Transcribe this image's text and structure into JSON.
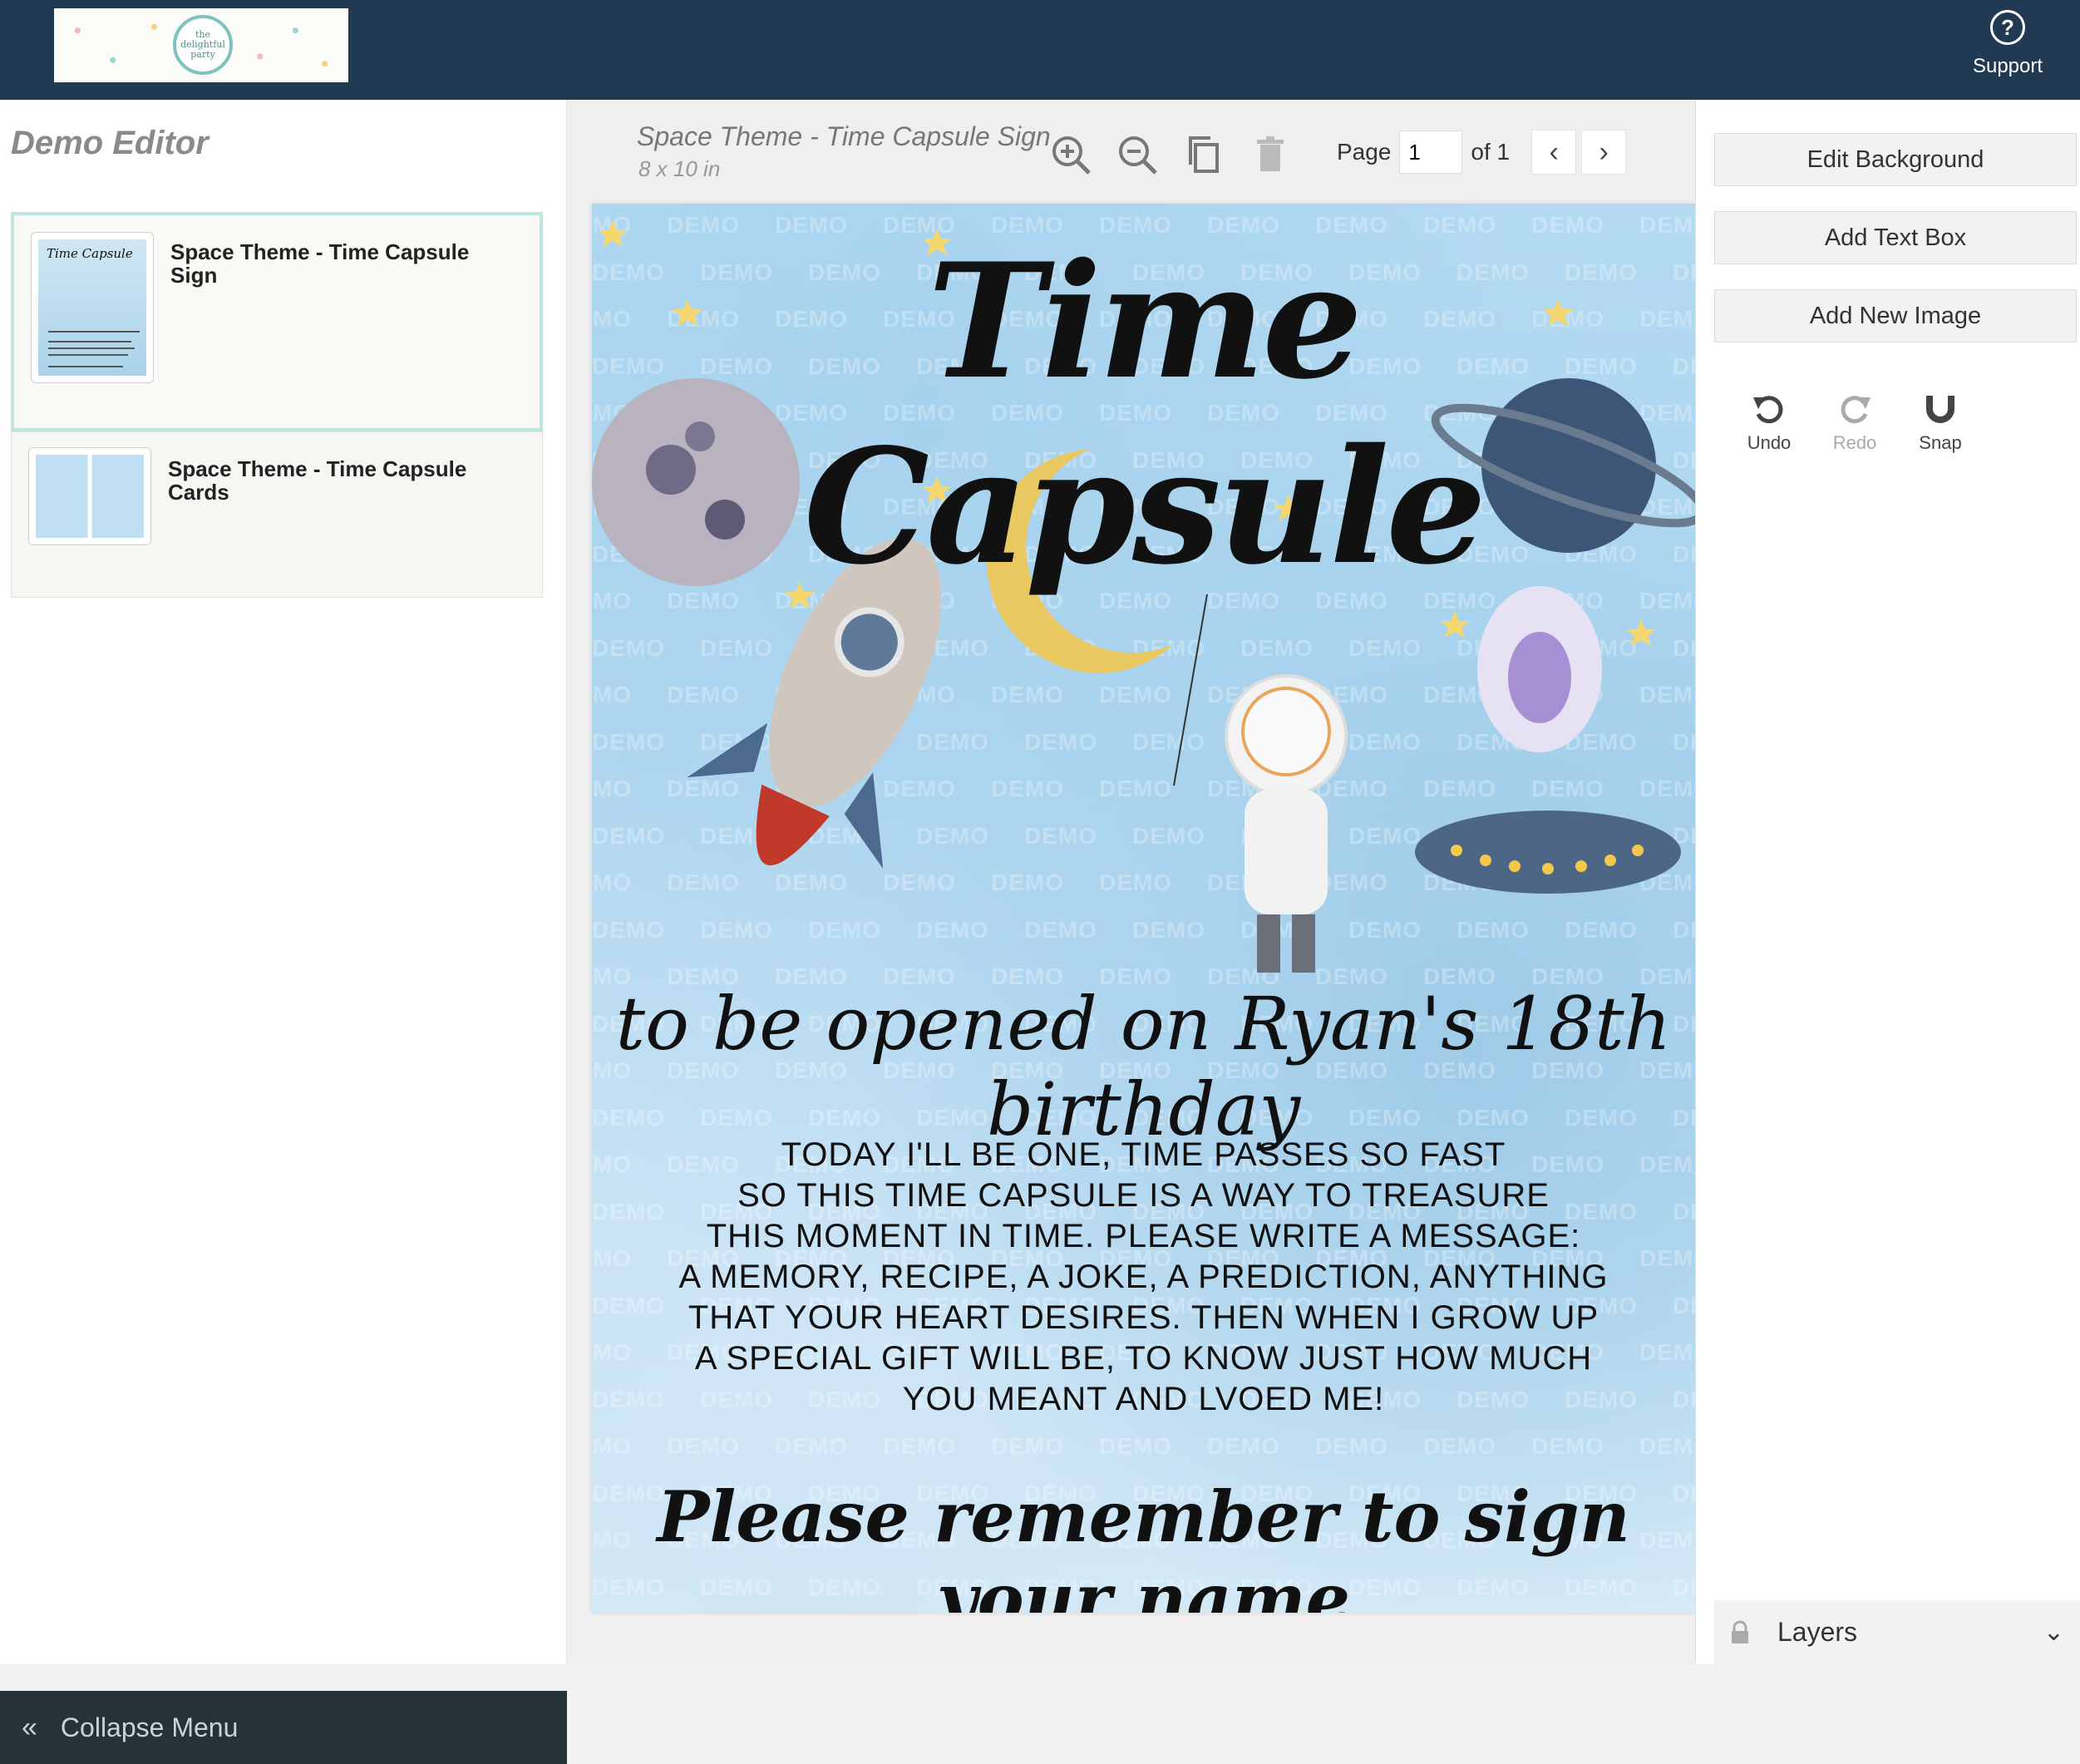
{
  "header": {
    "logo_text": "the delightful party",
    "support_label": "Support"
  },
  "sidebar": {
    "title": "Demo Editor",
    "templates": [
      {
        "name": "Space Theme - Time Capsule Sign",
        "active": true
      },
      {
        "name": "Space Theme - Time Capsule Cards",
        "active": false
      }
    ],
    "collapse_label": "Collapse Menu"
  },
  "document": {
    "title": "Space Theme - Time Capsule Sign",
    "size": "8 x 10 in",
    "page_label": "Page",
    "page_value": "1",
    "page_total": "of 1"
  },
  "design": {
    "watermark": "DEMO",
    "heading": "Time Capsule",
    "subheading": "to be opened on Ryan's 18th birthday",
    "poem_lines": [
      "TODAY I'LL BE ONE, TIME PASSES SO FAST",
      "SO THIS TIME CAPSULE IS A WAY TO TREASURE",
      "THIS MOMENT IN TIME. PLEASE WRITE A MESSAGE:",
      "A MEMORY, RECIPE, A JOKE, A PREDICTION, ANYTHING",
      "THAT YOUR HEART DESIRES. THEN WHEN I GROW UP",
      "A SPECIAL GIFT WILL BE, TO KNOW JUST HOW MUCH",
      "YOU MEANT AND LVOED ME!"
    ],
    "signline": "Please remember to sign your name"
  },
  "right_panel": {
    "edit_background": "Edit Background",
    "add_text_box": "Add Text Box",
    "add_new_image": "Add New Image",
    "undo": "Undo",
    "redo": "Redo",
    "snap": "Snap",
    "layers": "Layers"
  },
  "colors": {
    "header_bg": "#1f3a52",
    "collapse_bg": "#253339",
    "active_border": "#bde6e0"
  }
}
